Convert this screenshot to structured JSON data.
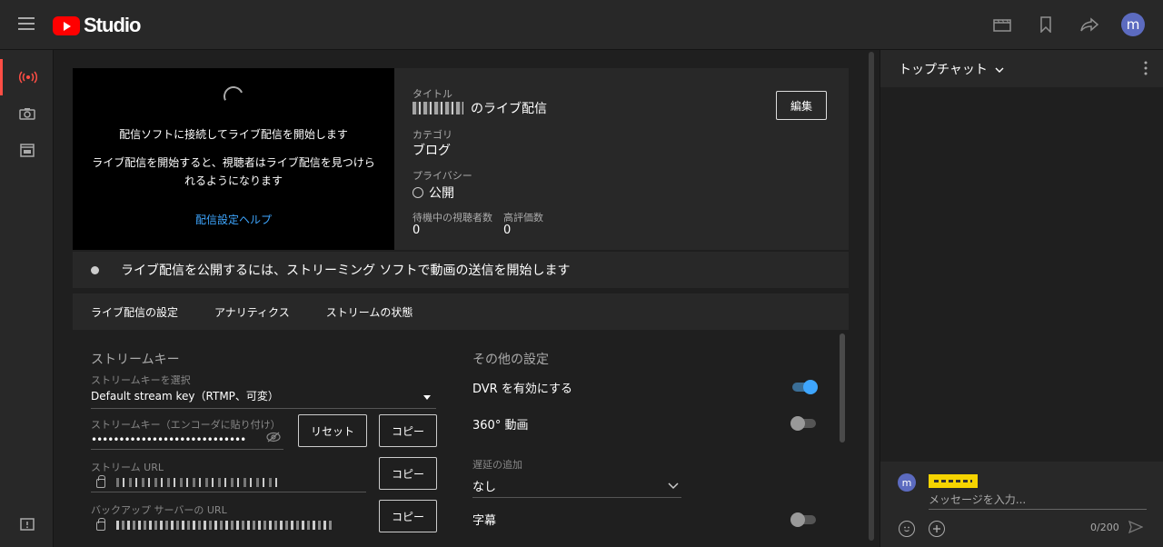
{
  "app": {
    "logo_text": "Studio",
    "brand_color": "#ff0000",
    "avatar_letter": "m"
  },
  "topbar": {
    "icons": [
      "clapperboard-icon",
      "bookmark-icon",
      "share-icon"
    ]
  },
  "sidenav": {
    "items": [
      "live-broadcast-icon",
      "camera-icon",
      "calendar-icon"
    ],
    "feedback_icon": "feedback-icon"
  },
  "preview": {
    "line1": "配信ソフトに接続してライブ配信を開始します",
    "line2": "ライブ配信を開始すると、視聴者はライブ配信を見つけられるようになります",
    "help_link": "配信設定ヘルプ"
  },
  "info": {
    "title_label": "タイトル",
    "title_suffix": "のライブ配信",
    "edit_button": "編集",
    "category_label": "カテゴリ",
    "category_value": "ブログ",
    "privacy_label": "プライバシー",
    "privacy_value": "公開",
    "waiting_label": "待機中の視聴者数",
    "waiting_value": "0",
    "likes_label": "高評価数",
    "likes_value": "0"
  },
  "status": {
    "text": "ライブ配信を公開するには、ストリーミング ソフトで動画の送信を開始します"
  },
  "tabs": [
    "ライブ配信の設定",
    "アナリティクス",
    "ストリームの状態"
  ],
  "stream": {
    "heading": "ストリームキー",
    "select_label": "ストリームキーを選択",
    "select_value": "Default stream key（RTMP、可変）",
    "key_label": "ストリームキー（エンコーダに貼り付け）",
    "key_value": "••••••••••••••••••••••••••••",
    "reset_button": "リセット",
    "copy_button": "コピー",
    "url_label": "ストリーム URL",
    "backup_label": "バックアップ サーバーの URL"
  },
  "other": {
    "heading": "その他の設定",
    "dvr_label": "DVR を有効にする",
    "dvr_on": true,
    "v360_label": "360° 動画",
    "v360_on": false,
    "latency_label": "遅延の追加",
    "latency_value": "なし",
    "captions_label": "字幕",
    "captions_on": false
  },
  "chat": {
    "title": "トップチャット",
    "placeholder": "メッセージを入力...",
    "counter": "0/200",
    "avatar_letter": "m"
  }
}
